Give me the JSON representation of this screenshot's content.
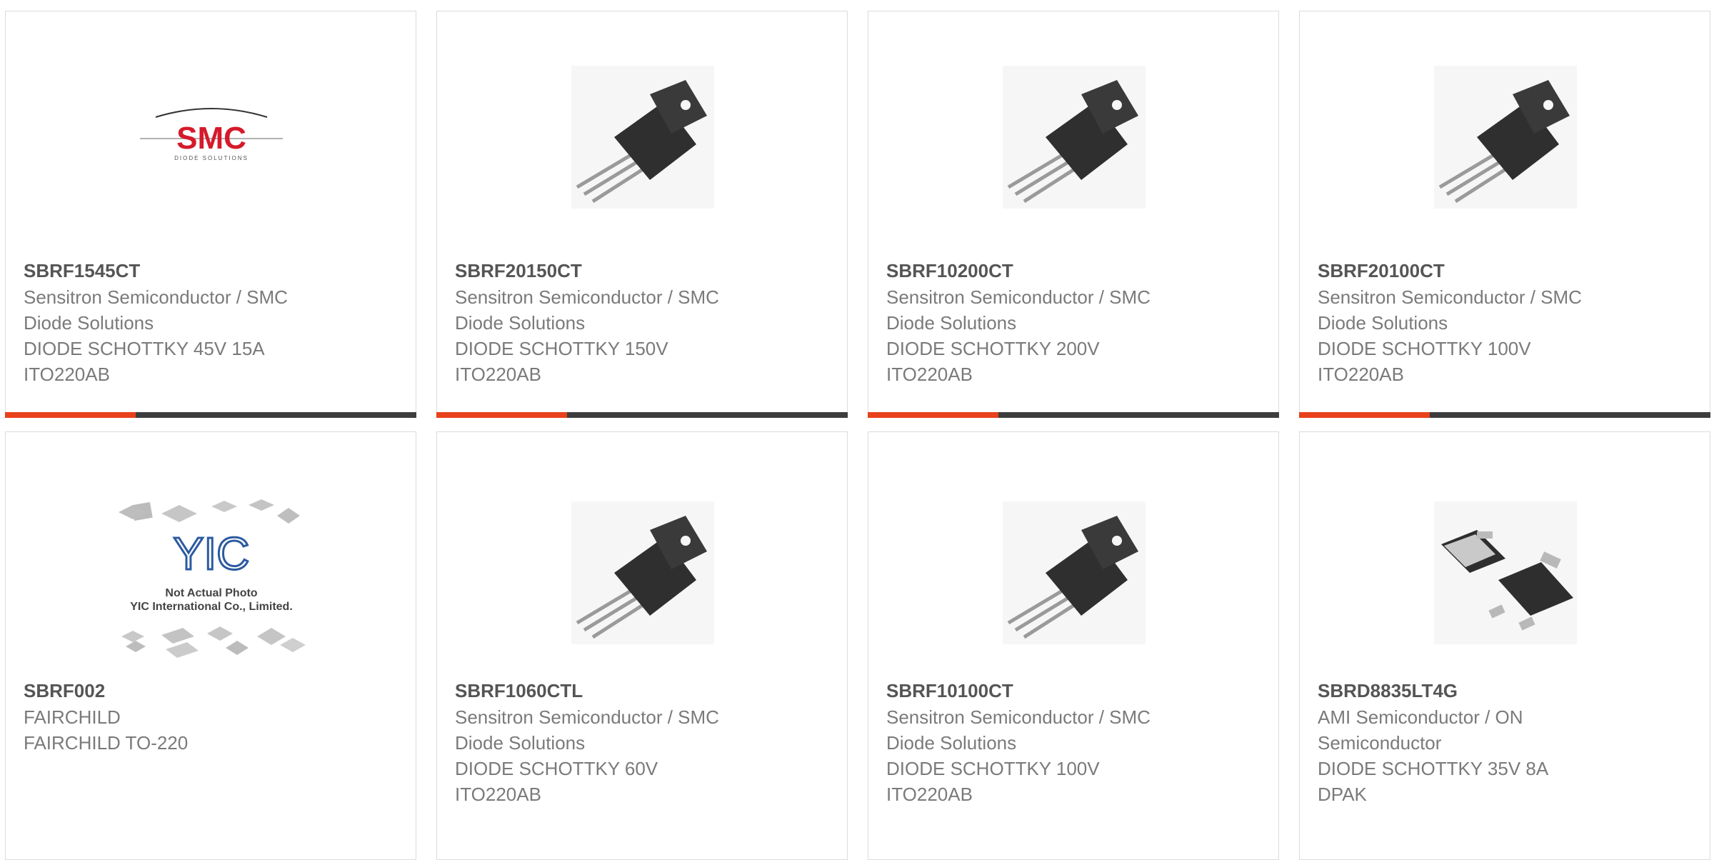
{
  "products": [
    {
      "part": "SBRF1545CT",
      "lines": [
        "Sensitron Semiconductor / SMC",
        "Diode Solutions",
        "DIODE SCHOTTKY 45V 15A",
        "ITO220AB"
      ],
      "image": "smc-logo",
      "logo_text": "SMC",
      "logo_sub": "DIODE SOLUTIONS"
    },
    {
      "part": "SBRF20150CT",
      "lines": [
        "Sensitron Semiconductor / SMC",
        "Diode Solutions",
        "DIODE SCHOTTKY 150V",
        "ITO220AB"
      ],
      "image": "to220-package"
    },
    {
      "part": "SBRF10200CT",
      "lines": [
        "Sensitron Semiconductor / SMC",
        "Diode Solutions",
        "DIODE SCHOTTKY 200V",
        "ITO220AB"
      ],
      "image": "to220-package"
    },
    {
      "part": "SBRF20100CT",
      "lines": [
        "Sensitron Semiconductor / SMC",
        "Diode Solutions",
        "DIODE SCHOTTKY 100V",
        "ITO220AB"
      ],
      "image": "to220-package"
    },
    {
      "part": "SBRF002",
      "lines": [
        "FAIRCHILD",
        "FAIRCHILD TO-220"
      ],
      "image": "yic-placeholder",
      "logo_text": "YIC",
      "caption1": "Not Actual Photo",
      "caption2": "YIC International Co., Limited."
    },
    {
      "part": "SBRF1060CTL",
      "lines": [
        "Sensitron Semiconductor / SMC",
        "Diode Solutions",
        "DIODE SCHOTTKY 60V",
        "ITO220AB"
      ],
      "image": "to220-package"
    },
    {
      "part": "SBRF10100CT",
      "lines": [
        "Sensitron Semiconductor / SMC",
        "Diode Solutions",
        "DIODE SCHOTTKY 100V",
        "ITO220AB"
      ],
      "image": "to220-package"
    },
    {
      "part": "SBRD8835LT4G",
      "lines": [
        "AMI Semiconductor / ON",
        "Semiconductor",
        "DIODE SCHOTTKY 35V 8A",
        "DPAK"
      ],
      "image": "dpak-package"
    }
  ],
  "colors": {
    "accent": "#e8411b",
    "bar": "#3d3d3d",
    "part_text": "#555555",
    "desc_text": "#7a7a7a",
    "border": "#dcdcdc"
  }
}
